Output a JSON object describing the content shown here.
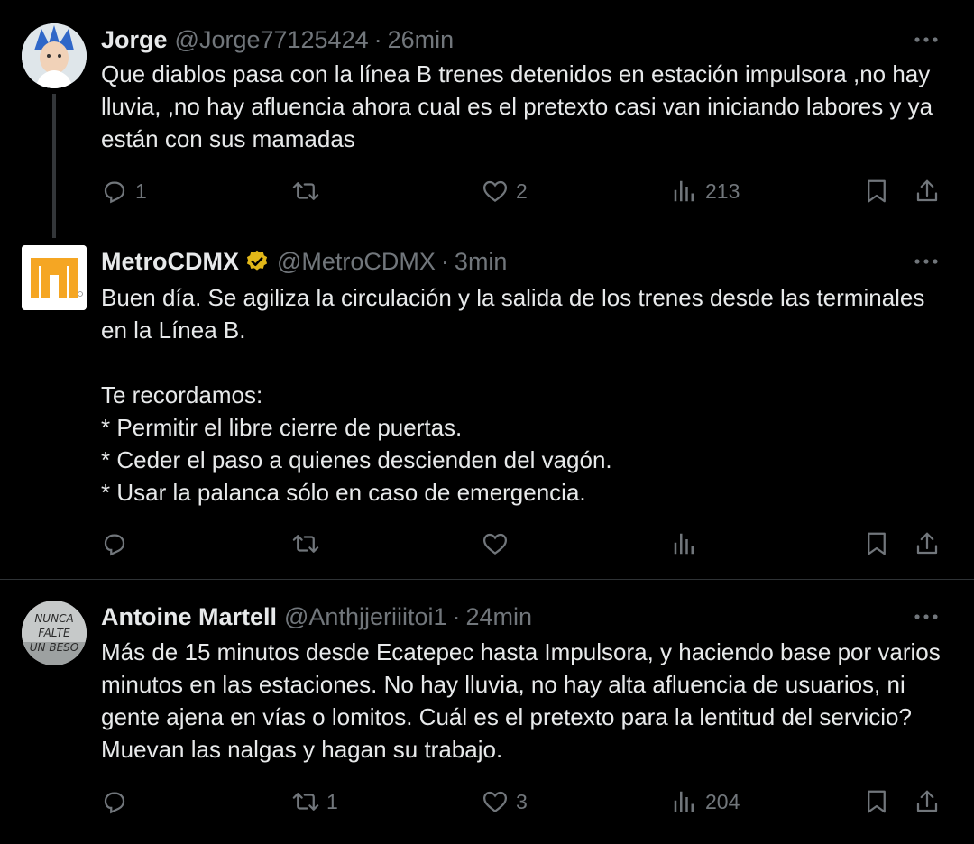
{
  "tweets": [
    {
      "name": "Jorge",
      "handle": "@Jorge77125424",
      "time": "26min",
      "text": "Que diablos pasa con la línea B trenes detenidos en estación impulsora ,no hay lluvia, ,no hay afluencia ahora cual es el pretexto casi van iniciando labores y ya están con sus mamadas",
      "replies": "1",
      "retweets": "",
      "likes": "2",
      "views": "213"
    },
    {
      "name": "MetroCDMX",
      "handle": "@MetroCDMX",
      "time": "3min",
      "text": "Buen día. Se agiliza la circulación y la salida de los trenes desde las terminales en la Línea B.\n\nTe recordamos:\n* Permitir el libre cierre de puertas.\n* Ceder el paso a quienes descienden del vagón.\n* Usar la palanca sólo en caso de emergencia.",
      "replies": "",
      "retweets": "",
      "likes": "",
      "views": ""
    },
    {
      "name": "Antoine Martell",
      "handle": "@Anthjjeriiitoi1",
      "time": "24min",
      "text": "Más de 15 minutos desde Ecatepec hasta Impulsora, y haciendo base por varios minutos en las estaciones. No hay lluvia, no hay alta afluencia de usuarios, ni gente ajena en vías o lomitos. Cuál es el pretexto para la lentitud del servicio? Muevan las nalgas y hagan su trabajo.",
      "replies": "",
      "retweets": "1",
      "likes": "3",
      "views": "204"
    }
  ],
  "avatar_art": {
    "antoine_text": "NUNCA FALTE UN BESO"
  },
  "colors": {
    "background": "#000000",
    "text": "#e7e9ea",
    "muted": "#71767b",
    "metro_orange": "#f5a623",
    "verified_gold": "#e2b719"
  },
  "icons": [
    "reply-icon",
    "retweet-icon",
    "like-icon",
    "views-icon",
    "bookmark-icon",
    "share-icon",
    "more-icon",
    "verified-badge-icon"
  ]
}
